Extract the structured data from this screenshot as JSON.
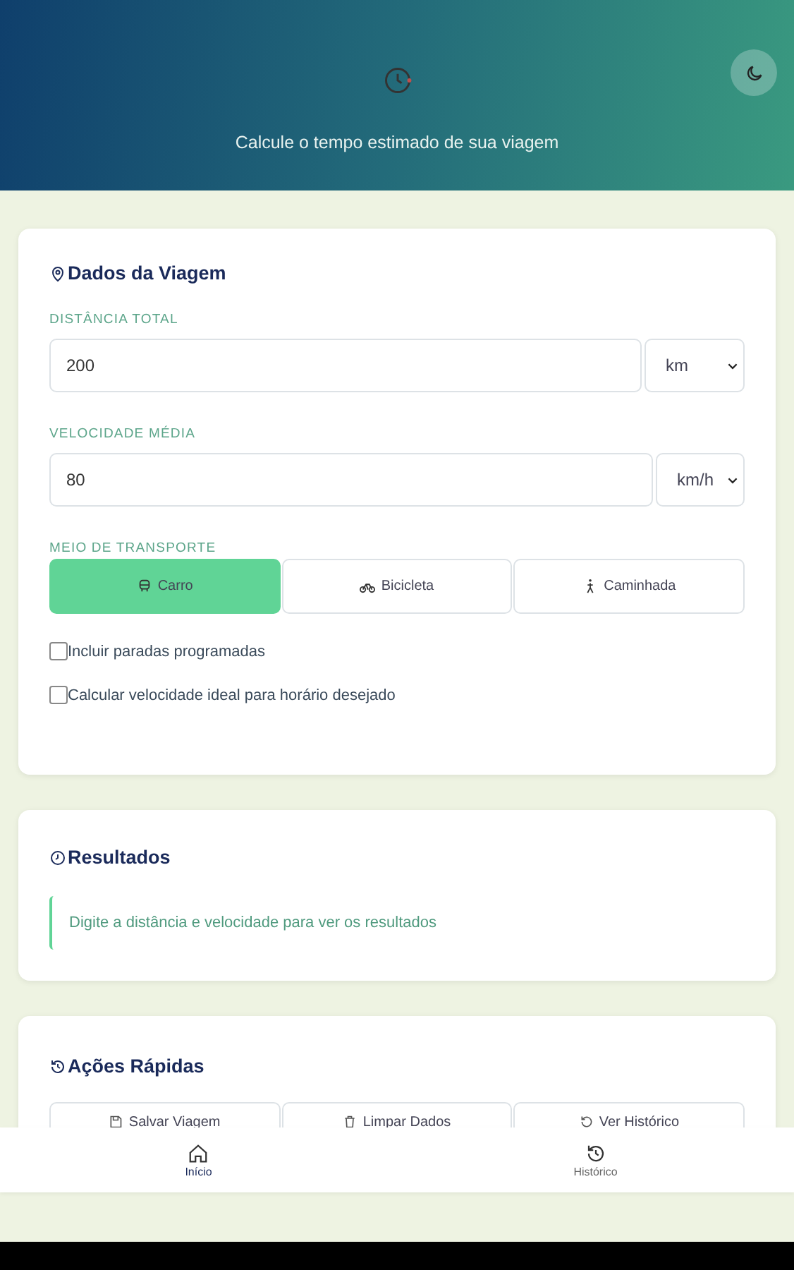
{
  "header": {
    "subtitle": "Calcule o tempo estimado de sua viagem"
  },
  "trip": {
    "title": "Dados da Viagem",
    "distance": {
      "label": "DISTÂNCIA TOTAL",
      "value": "200",
      "unit": "km"
    },
    "speed": {
      "label": "VELOCIDADE MÉDIA",
      "value": "80",
      "unit": "km/h"
    },
    "transport_label": "MEIO DE TRANSPORTE",
    "transport": [
      {
        "kind": "car",
        "label": "Carro",
        "selected": true
      },
      {
        "kind": "bike",
        "label": "Bicicleta",
        "selected": false
      },
      {
        "kind": "walk",
        "label": "Caminhada",
        "selected": false
      }
    ],
    "options": [
      {
        "label": "Incluir paradas programadas",
        "checked": false
      },
      {
        "label": "Calcular velocidade ideal para horário desejado",
        "checked": false
      }
    ]
  },
  "results": {
    "title": "Resultados",
    "message": "Digite a distância e velocidade para ver os resultados"
  },
  "quick": {
    "title": "Ações Rápidas",
    "actions": [
      {
        "kind": "save",
        "label": "Salvar Viagem"
      },
      {
        "kind": "clear",
        "label": "Limpar Dados"
      },
      {
        "kind": "history",
        "label": "Ver Histórico"
      }
    ]
  },
  "nav": [
    {
      "kind": "home",
      "label": "Início",
      "selected": true
    },
    {
      "kind": "history",
      "label": "Histórico",
      "selected": false
    }
  ]
}
